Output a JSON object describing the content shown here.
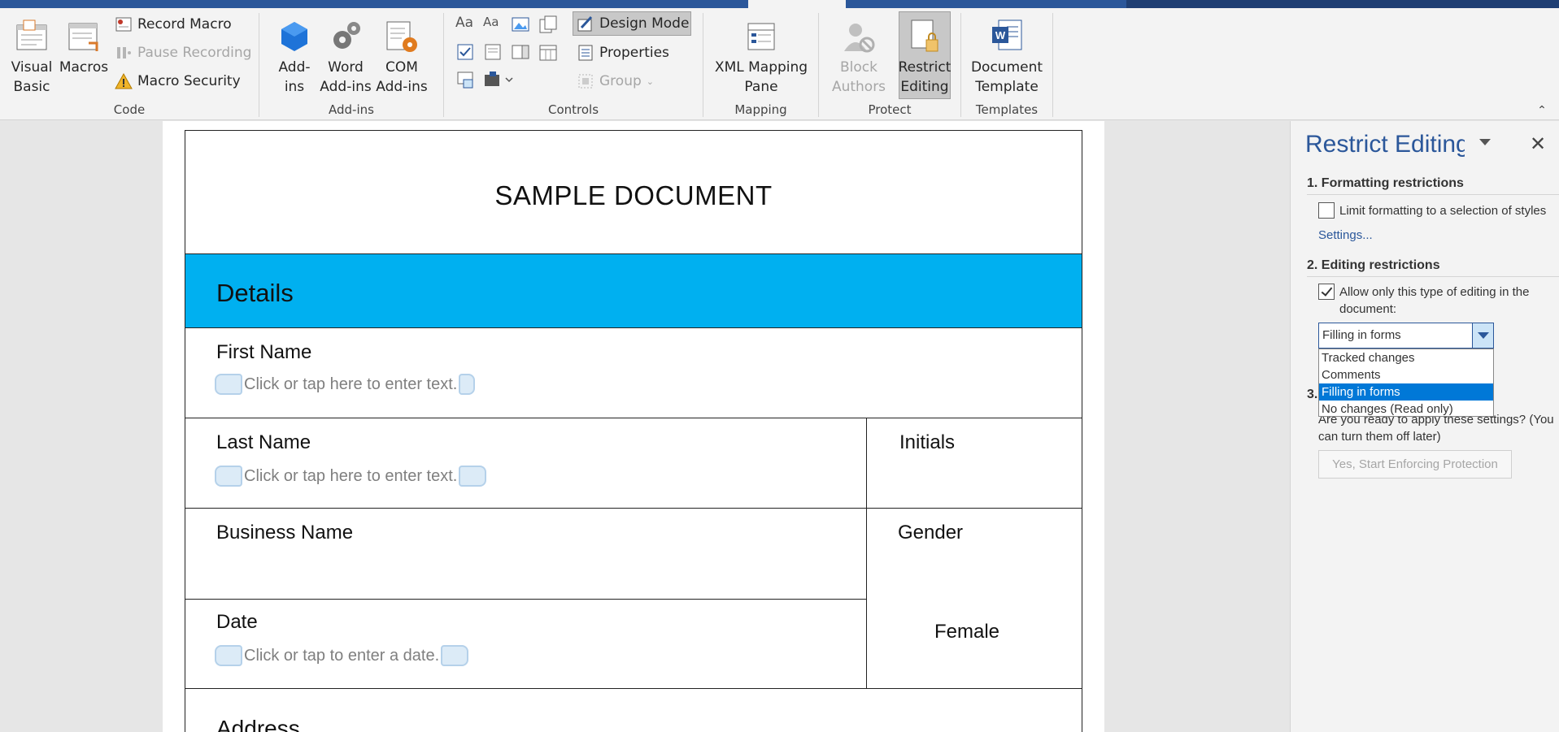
{
  "ribbon": {
    "code": {
      "label": "Code",
      "visual_basic": "Visual Basic",
      "visual_basic_l1": "Visual",
      "visual_basic_l2": "Basic",
      "macros": "Macros",
      "record_macro": "Record Macro",
      "pause_recording": "Pause Recording",
      "macro_security": "Macro Security"
    },
    "addins": {
      "label": "Add-ins",
      "addins_l1": "Add-",
      "addins_l2": "ins",
      "word_addins_l1": "Word",
      "word_addins_l2": "Add-ins",
      "com_addins_l1": "COM",
      "com_addins_l2": "Add-ins"
    },
    "controls": {
      "label": "Controls",
      "design_mode": "Design Mode",
      "properties": "Properties",
      "group": "Group"
    },
    "mapping": {
      "label": "Mapping",
      "xml_l1": "XML Mapping",
      "xml_l2": "Pane"
    },
    "protect": {
      "label": "Protect",
      "block_l1": "Block",
      "block_l2": "Authors",
      "restrict_l1": "Restrict",
      "restrict_l2": "Editing"
    },
    "templates": {
      "label": "Templates",
      "doc_l1": "Document",
      "doc_l2": "Template"
    }
  },
  "document": {
    "title": "SAMPLE DOCUMENT",
    "section": "Details",
    "first_name_label": "First Name",
    "first_name_placeholder": "Click or tap here to enter text.",
    "last_name_label": "Last Name",
    "last_name_placeholder": "Click or tap here to enter text.",
    "initials_label": "Initials",
    "business_name_label": "Business Name",
    "gender_label": "Gender",
    "gender_value": "Female",
    "date_label": "Date",
    "date_placeholder": "Click or tap to enter a date.",
    "address_label": "Address"
  },
  "pane": {
    "title": "Restrict Editing",
    "sec1": "1. Formatting restrictions",
    "limit_formatting": "Limit formatting to a selection of styles",
    "limit_formatting_checked": false,
    "settings_link": "Settings...",
    "sec2": "2. Editing restrictions",
    "allow_line1": "Allow only this type of editing in the",
    "allow_line2": "document:",
    "allow_checked": true,
    "combo_value": "Filling in forms",
    "options": [
      "Tracked changes",
      "Comments",
      "Filling in forms",
      "No changes (Read only)"
    ],
    "selected_option": "Filling in forms",
    "sec3_number": "3.",
    "apply_line1": "Are you ready to apply these settings? (You",
    "apply_line2": "can turn them off later)",
    "enforce_button": "Yes, Start Enforcing Protection"
  },
  "colors": {
    "accent": "#2b579a",
    "details_band": "#00b0f0",
    "selection": "#0078d7"
  }
}
